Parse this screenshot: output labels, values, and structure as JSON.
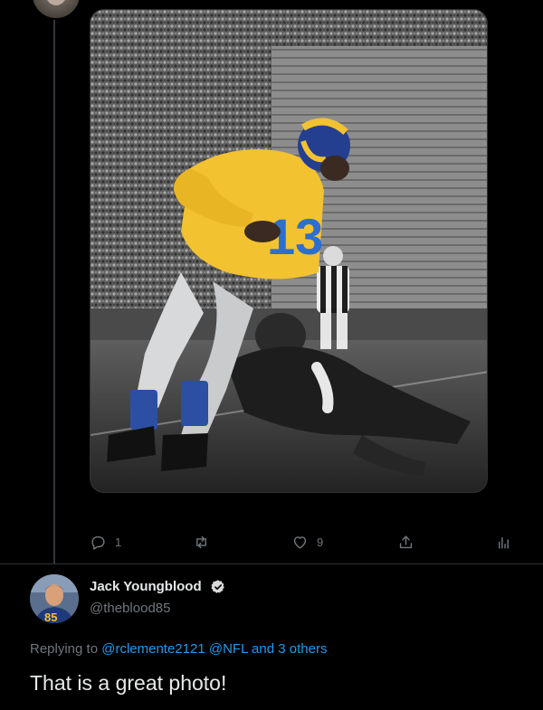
{
  "parent_tweet": {
    "media_alt": "photo",
    "jersey_number": "13",
    "actions": {
      "reply_count": "1",
      "retweet_count": "",
      "like_count": "9"
    }
  },
  "reply": {
    "author_name": "Jack Youngblood",
    "handle": "@theblood85",
    "replying_prefix": "Replying to",
    "replying_user1": "@rclemente2121",
    "replying_user2": "@NFL",
    "replying_and": "and",
    "replying_others": "3 others",
    "text": "That is a great photo!",
    "avatar_jersey": "85"
  },
  "colors": {
    "background": "#000000",
    "text_primary": "#e7e9ea",
    "text_secondary": "#71767b",
    "link": "#1d9bf0",
    "divider": "#2f3336",
    "verified": "#d9d9d9"
  },
  "icons": {
    "reply": "reply-icon",
    "retweet": "retweet-icon",
    "like": "heart-icon",
    "share": "share-icon",
    "stats": "analytics-icon",
    "verified": "verified-badge-icon"
  }
}
